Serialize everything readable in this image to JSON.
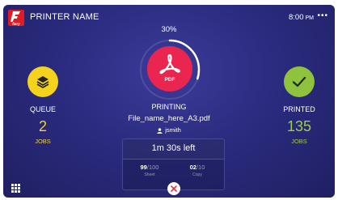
{
  "header": {
    "logo_text": "fiery",
    "printer_name": "PRINTER NAME",
    "time": "8:00",
    "ampm": "PM",
    "more_label": "•••"
  },
  "job": {
    "progress_percent_label": "30%",
    "progress_fraction": 0.3,
    "file_type": "PDF",
    "status": "PRINTING",
    "filename": "File_name_here_A3.pdf",
    "user": "jsmith",
    "time_left": "1m 30s left",
    "sheet_current": "99",
    "sheet_total": "100",
    "sheet_label": "Sheet",
    "copy_current": "02",
    "copy_total": "10",
    "copy_label": "Copy",
    "separator": "/"
  },
  "queue": {
    "title": "QUEUE",
    "count": "2",
    "unit": "JOBS"
  },
  "printed": {
    "title": "PRINTED",
    "count": "135",
    "unit": "JOBS"
  },
  "colors": {
    "background": "#2b2b80",
    "pdf_accent": "#ea2650",
    "queue_accent": "#f5d31d",
    "printed_accent": "#8fc23d",
    "logo_red": "#e21b23"
  },
  "icons": {
    "logo": "fiery-logo-icon",
    "pdf": "acrobat-pdf-icon",
    "queue": "stack-layers-icon",
    "printed": "checkmark-icon",
    "user": "user-icon",
    "cancel": "close-icon",
    "apps": "grid-apps-icon"
  }
}
